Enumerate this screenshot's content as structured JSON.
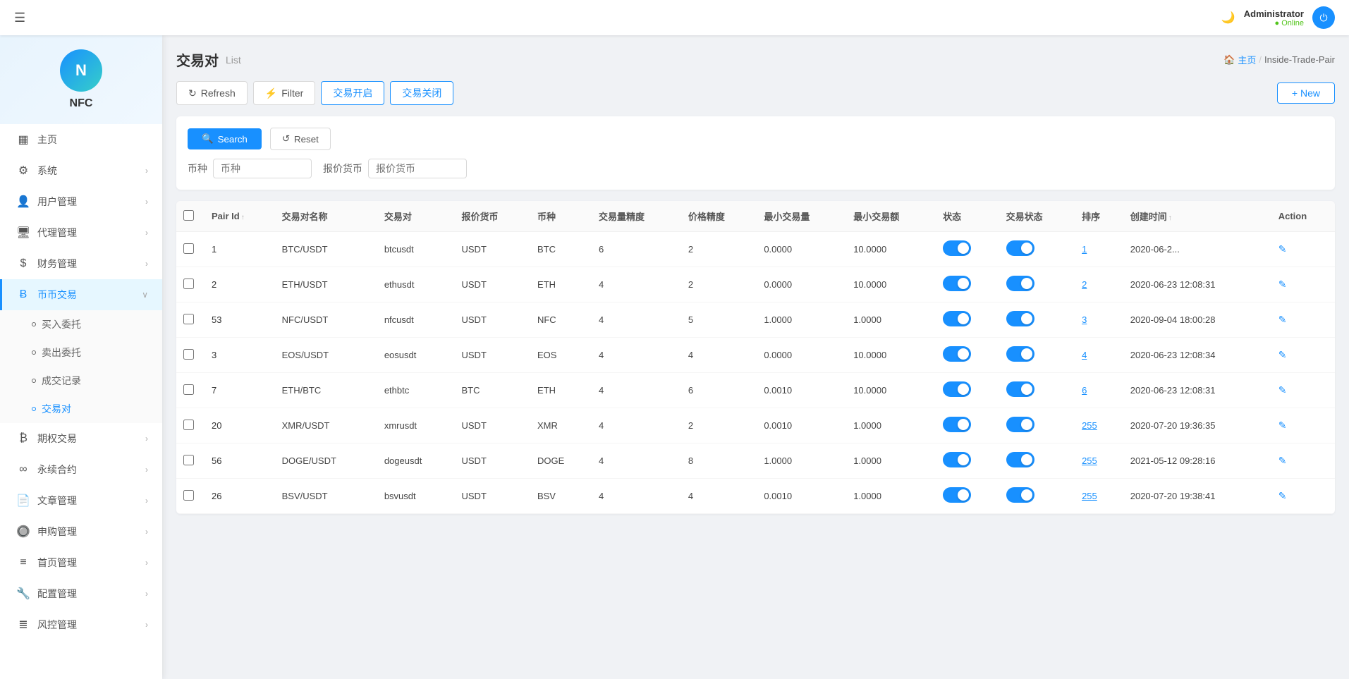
{
  "topbar": {
    "menu_icon": "☰",
    "user_name": "Administrator",
    "user_status": "Online",
    "moon_icon": "☽",
    "power_icon": "⏻"
  },
  "sidebar": {
    "logo_text": "NFC",
    "nav_items": [
      {
        "id": "home",
        "icon": "▦",
        "label": "主页",
        "has_arrow": false,
        "active": false
      },
      {
        "id": "system",
        "icon": "⚙",
        "label": "系统",
        "has_arrow": true,
        "active": false
      },
      {
        "id": "user-mgmt",
        "icon": "👤",
        "label": "用户管理",
        "has_arrow": true,
        "active": false
      },
      {
        "id": "agent-mgmt",
        "icon": "🖥",
        "label": "代理管理",
        "has_arrow": true,
        "active": false
      },
      {
        "id": "finance-mgmt",
        "icon": "$",
        "label": "财务管理",
        "has_arrow": true,
        "active": false
      },
      {
        "id": "coin-trade",
        "icon": "B",
        "label": "币币交易",
        "has_arrow": true,
        "active": true,
        "expanded": true
      }
    ],
    "sub_items": [
      {
        "id": "buy-delegate",
        "label": "买入委托",
        "active": false
      },
      {
        "id": "sell-delegate",
        "label": "卖出委托",
        "active": false
      },
      {
        "id": "trade-record",
        "label": "成交记录",
        "active": false
      },
      {
        "id": "trade-pair",
        "label": "交易对",
        "active": true
      }
    ],
    "nav_items2": [
      {
        "id": "futures",
        "icon": "₿",
        "label": "期权交易",
        "has_arrow": true
      },
      {
        "id": "perpetual",
        "icon": "∞",
        "label": "永续合约",
        "has_arrow": true
      },
      {
        "id": "article",
        "icon": "📄",
        "label": "文章管理",
        "has_arrow": true
      },
      {
        "id": "purchase",
        "icon": "🔘",
        "label": "申购管理",
        "has_arrow": true
      },
      {
        "id": "homepage",
        "icon": "≡",
        "label": "首页管理",
        "has_arrow": true
      },
      {
        "id": "config",
        "icon": "🔧",
        "label": "配置管理",
        "has_arrow": true
      },
      {
        "id": "risk",
        "icon": "≣",
        "label": "风控管理",
        "has_arrow": true
      }
    ]
  },
  "page": {
    "title": "交易对",
    "subtitle": "List",
    "breadcrumb_home": "主页",
    "breadcrumb_current": "Inside-Trade-Pair"
  },
  "toolbar": {
    "refresh_label": "Refresh",
    "filter_label": "Filter",
    "open_trade_label": "交易开启",
    "close_trade_label": "交易关闭",
    "new_label": "+ New"
  },
  "search": {
    "search_btn": "Search",
    "reset_btn": "Reset",
    "coin_label": "币种",
    "coin_placeholder": "币种",
    "quote_label": "报价货币",
    "quote_placeholder": "报价货币"
  },
  "table": {
    "columns": [
      "Pair Id",
      "交易对名称",
      "交易对",
      "报价货币",
      "币种",
      "交易量精度",
      "价格精度",
      "最小交易量",
      "最小交易额",
      "状态",
      "交易状态",
      "排序",
      "创建时间",
      "Action"
    ],
    "rows": [
      {
        "pair_id": "1",
        "name": "BTC/USDT",
        "pair": "btcusdt",
        "quote": "USDT",
        "coin": "BTC",
        "vol_precision": "6",
        "price_precision": "2",
        "min_vol": "0.0000",
        "min_amt": "10.0000",
        "status": true,
        "trade_status": true,
        "sort": "1",
        "created": "2020-06-2..."
      },
      {
        "pair_id": "2",
        "name": "ETH/USDT",
        "pair": "ethusdt",
        "quote": "USDT",
        "coin": "ETH",
        "vol_precision": "4",
        "price_precision": "2",
        "min_vol": "0.0000",
        "min_amt": "10.0000",
        "status": true,
        "trade_status": true,
        "sort": "2",
        "created": "2020-06-23 12:08:31"
      },
      {
        "pair_id": "53",
        "name": "NFC/USDT",
        "pair": "nfcusdt",
        "quote": "USDT",
        "coin": "NFC",
        "vol_precision": "4",
        "price_precision": "5",
        "min_vol": "1.0000",
        "min_amt": "1.0000",
        "status": true,
        "trade_status": true,
        "sort": "3",
        "created": "2020-09-04 18:00:28"
      },
      {
        "pair_id": "3",
        "name": "EOS/USDT",
        "pair": "eosusdt",
        "quote": "USDT",
        "coin": "EOS",
        "vol_precision": "4",
        "price_precision": "4",
        "min_vol": "0.0000",
        "min_amt": "10.0000",
        "status": true,
        "trade_status": true,
        "sort": "4",
        "created": "2020-06-23 12:08:34"
      },
      {
        "pair_id": "7",
        "name": "ETH/BTC",
        "pair": "ethbtc",
        "quote": "BTC",
        "coin": "ETH",
        "vol_precision": "4",
        "price_precision": "6",
        "min_vol": "0.0010",
        "min_amt": "10.0000",
        "status": true,
        "trade_status": true,
        "sort": "6",
        "created": "2020-06-23 12:08:31"
      },
      {
        "pair_id": "20",
        "name": "XMR/USDT",
        "pair": "xmrusdt",
        "quote": "USDT",
        "coin": "XMR",
        "vol_precision": "4",
        "price_precision": "2",
        "min_vol": "0.0010",
        "min_amt": "1.0000",
        "status": true,
        "trade_status": true,
        "sort": "255",
        "created": "2020-07-20 19:36:35"
      },
      {
        "pair_id": "56",
        "name": "DOGE/USDT",
        "pair": "dogeusdt",
        "quote": "USDT",
        "coin": "DOGE",
        "vol_precision": "4",
        "price_precision": "8",
        "min_vol": "1.0000",
        "min_amt": "1.0000",
        "status": true,
        "trade_status": true,
        "sort": "255",
        "created": "2021-05-12 09:28:16"
      },
      {
        "pair_id": "26",
        "name": "BSV/USDT",
        "pair": "bsvusdt",
        "quote": "USDT",
        "coin": "BSV",
        "vol_precision": "4",
        "price_precision": "4",
        "min_vol": "0.0010",
        "min_amt": "1.0000",
        "status": true,
        "trade_status": true,
        "sort": "255",
        "created": "2020-07-20 19:38:41"
      }
    ]
  }
}
